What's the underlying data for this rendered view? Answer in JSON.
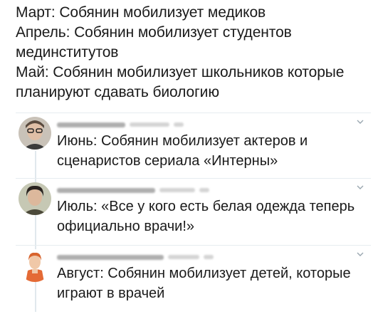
{
  "main_tweet": {
    "lines": [
      "Март: Собянин мобилизует медиков",
      "Апрель: Собянин мобилизует студентов мединститутов",
      "Май: Собянин мобилизует школьников которые планируют сдавать биологию"
    ]
  },
  "replies": [
    {
      "text": "Июнь: Собянин мобилизует актеров и сценаристов сериала «Интерны»",
      "avatar_icon": "person-with-glasses-avatar"
    },
    {
      "text": "Июль: «Все у кого есть белая одежда теперь официально врачи!»",
      "avatar_icon": "person-dark-hair-avatar"
    },
    {
      "text": "Август: Собянин мобилизует детей, которые играют в врачей",
      "avatar_icon": "person-red-hair-avatar"
    }
  ],
  "colors": {
    "text": "#1a1a1a",
    "thread_line": "#e1e8ed",
    "divider": "#e6ecf0",
    "blurred_name": "#6d6d6d"
  }
}
